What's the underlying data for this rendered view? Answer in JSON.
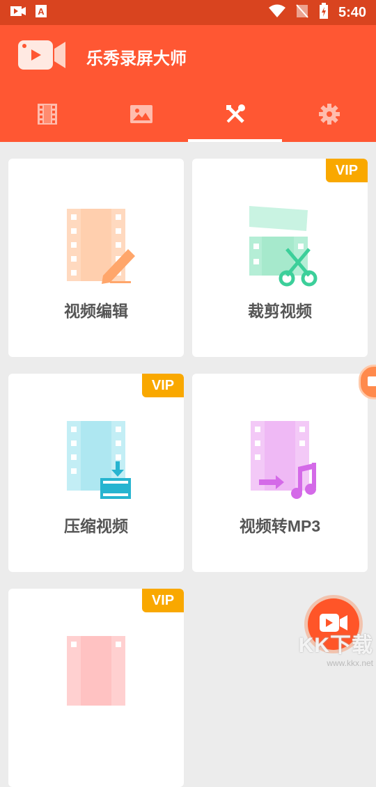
{
  "status_bar": {
    "time": "5:40"
  },
  "header": {
    "app_title": "乐秀录屏大师"
  },
  "tabs": [
    {
      "icon": "film-icon",
      "active": false
    },
    {
      "icon": "image-icon",
      "active": false
    },
    {
      "icon": "tools-icon",
      "active": true
    },
    {
      "icon": "gear-icon",
      "active": false
    }
  ],
  "cards": [
    {
      "label": "视频编辑",
      "vip": false
    },
    {
      "label": "裁剪视频",
      "vip": true
    },
    {
      "label": "压缩视频",
      "vip": true
    },
    {
      "label": "视频转MP3",
      "vip": false
    },
    {
      "label": "",
      "vip": true
    }
  ],
  "vip_badge": "VIP",
  "watermark": {
    "logo_text": "KK下载",
    "url": "www.kkx.net"
  },
  "colors": {
    "header": "#ff5733",
    "status_bar": "#d9441f",
    "vip": "#f9a800",
    "background": "#ececec"
  }
}
